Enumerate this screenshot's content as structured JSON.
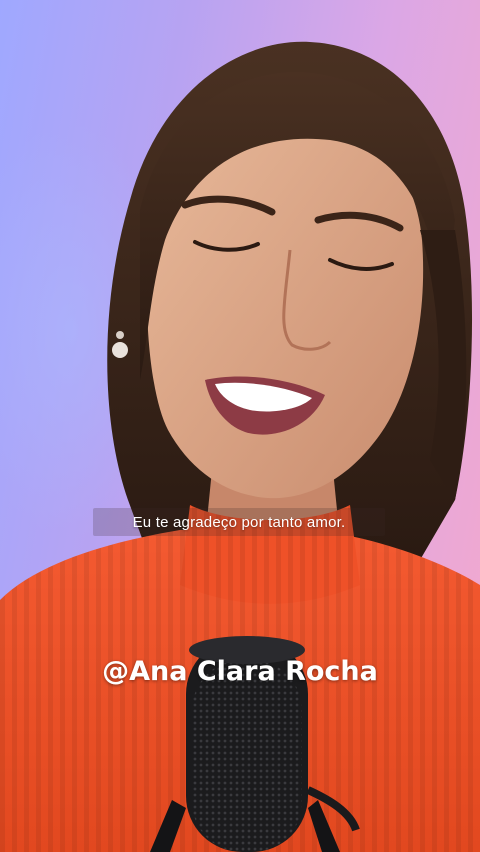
{
  "video": {
    "subtitle": "Eu te agradeço por tanto amor.",
    "creator_handle": "@Ana Clara Rocha"
  },
  "colors": {
    "background_left": "#9fa8ff",
    "background_right": "#f4a9cc",
    "sweater": "#f2572f",
    "hair": "#3a2418",
    "microphone": "#1b1b1d",
    "text": "#ffffff"
  }
}
